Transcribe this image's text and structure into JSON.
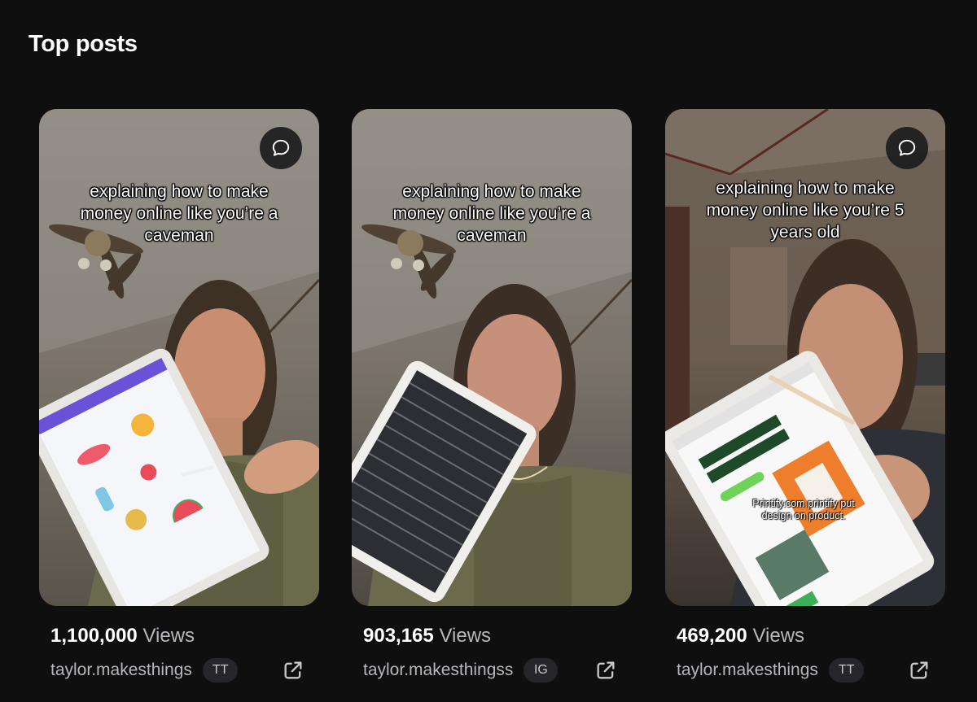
{
  "section": {
    "title": "Top posts"
  },
  "posts": [
    {
      "caption": "explaining how to make money online like you’re a caveman",
      "views_number": "1,100,000",
      "views_label": "Views",
      "handle": "taylor.makesthings",
      "platform_badge": "TT",
      "icons": {
        "comment": "comment-bubble-icon",
        "external": "external-link-icon"
      }
    },
    {
      "caption": "explaining how to make money online like you’re a caveman",
      "views_number": "903,165",
      "views_label": "Views",
      "handle": "taylor.makesthingss",
      "platform_badge": "IG",
      "icons": {
        "external": "external-link-icon"
      }
    },
    {
      "caption": "explaining how to make money online like you’re 5 years old",
      "overlay_text": "Printify.com printify put design on product.",
      "views_number": "469,200",
      "views_label": "Views",
      "handle": "taylor.makesthings",
      "platform_badge": "TT",
      "icons": {
        "comment": "comment-bubble-icon",
        "external": "external-link-icon"
      }
    }
  ],
  "colors": {
    "background": "#0f0f10",
    "badge_bg": "#26262a",
    "muted_text": "#b7b7bb"
  }
}
